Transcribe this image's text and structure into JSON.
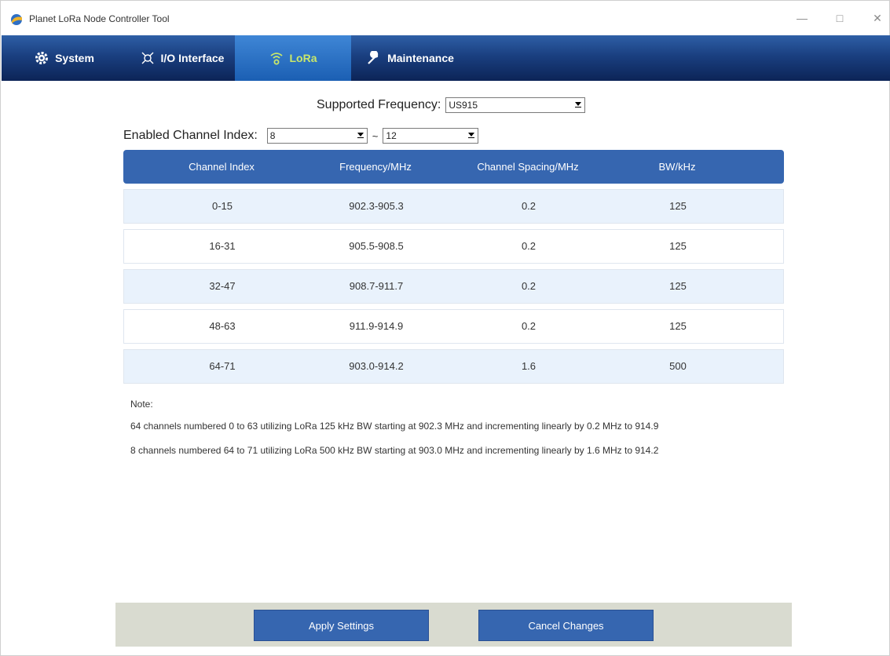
{
  "window": {
    "title": "Planet LoRa Node Controller Tool"
  },
  "tabs": [
    {
      "label": "System",
      "icon": "gear-icon"
    },
    {
      "label": "I/O Interface",
      "icon": "io-interface-icon"
    },
    {
      "label": "LoRa",
      "icon": "wireless-signal-icon"
    },
    {
      "label": "Maintenance",
      "icon": "wrench-icon"
    }
  ],
  "active_tab": "LoRa",
  "frequency": {
    "label": "Supported Frequency:",
    "value": "US915"
  },
  "channel_index": {
    "label": "Enabled Channel Index:",
    "start": "8",
    "separator": "~",
    "end": "12"
  },
  "table": {
    "headers": [
      "Channel Index",
      "Frequency/MHz",
      "Channel Spacing/MHz",
      "BW/kHz"
    ],
    "rows": [
      [
        "0-15",
        "902.3-905.3",
        "0.2",
        "125"
      ],
      [
        "16-31",
        "905.5-908.5",
        "0.2",
        "125"
      ],
      [
        "32-47",
        "908.7-911.7",
        "0.2",
        "125"
      ],
      [
        "48-63",
        "911.9-914.9",
        "0.2",
        "125"
      ],
      [
        "64-71",
        "903.0-914.2",
        "1.6",
        "500"
      ]
    ]
  },
  "note": {
    "label": "Note:",
    "lines": [
      "64 channels numbered 0 to 63 utilizing LoRa 125 kHz BW starting at 902.3 MHz and incrementing linearly by 0.2 MHz to 914.9",
      "8 channels numbered 64 to 71 utilizing LoRa 500 kHz BW starting at 903.0 MHz and incrementing linearly by 1.6 MHz to 914.2"
    ]
  },
  "buttons": {
    "apply": "Apply Settings",
    "cancel": "Cancel Changes"
  },
  "colors": {
    "nav_top": "#2e5fa6",
    "nav_bottom": "#0c2457",
    "accent": "#3666b0",
    "row_alt": "#e9f2fc",
    "footer_bg": "#d9dbd0"
  }
}
